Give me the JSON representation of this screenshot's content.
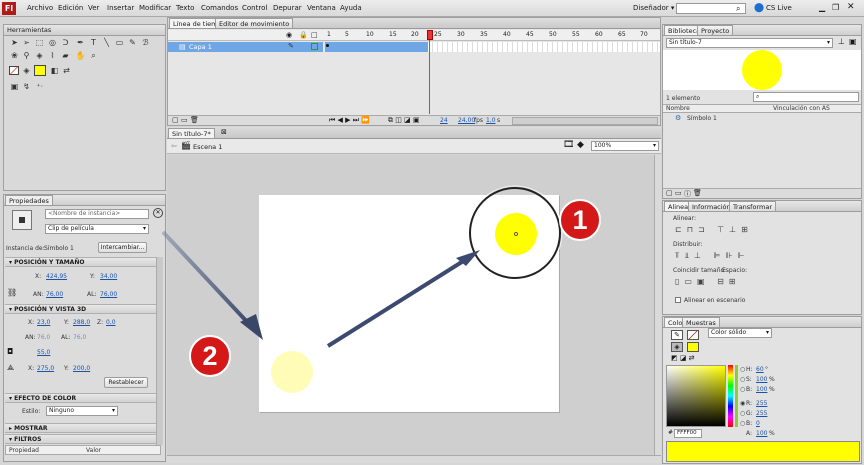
{
  "menu": [
    "Archivo",
    "Edición",
    "Ver",
    "Insertar",
    "Modificar",
    "Texto",
    "Comandos",
    "Control",
    "Depurar",
    "Ventana",
    "Ayuda"
  ],
  "app": {
    "logo": "Fl",
    "workspace": "Diseñador",
    "cslive": "CS Live",
    "search_placeholder": ""
  },
  "tools": {
    "title": "Herramientas"
  },
  "timeline": {
    "tabs": [
      "Línea de tiempo",
      "Editor de movimiento"
    ],
    "layer": "Capa 1",
    "frames": [
      "1",
      "5",
      "10",
      "15",
      "20",
      "25",
      "30",
      "35",
      "40",
      "45",
      "50",
      "55",
      "60",
      "65",
      "70"
    ],
    "frame_current": "24",
    "fps": "24,00",
    "fps_unit": "fps",
    "time": "1,0",
    "time_unit": "s"
  },
  "doc": {
    "tab": "Sin título-7*",
    "scene": "Escena 1",
    "zoom": "100%"
  },
  "properties": {
    "tab": "Propiedades",
    "instance_placeholder": "<Nombre de instancia>",
    "instance_type": "Clip de película",
    "instance_of_label": "Instancia de:",
    "instance_of": "Símbolo 1",
    "swap": "Intercambiar...",
    "sec_pos": "POSICIÓN Y TAMAÑO",
    "x_label": "X:",
    "x": "424,95",
    "y_label": "Y:",
    "y": "34,00",
    "w_label": "AN:",
    "w": "76,00",
    "h_label": "AL:",
    "h": "76,00",
    "sec_3d": "POSICIÓN Y VISTA 3D",
    "x3_label": "X:",
    "x3": "23,0",
    "y3_label": "Y:",
    "y3": "288,0",
    "z_label": "Z:",
    "z": "0,0",
    "w3_label": "AN:",
    "w3": "76,0",
    "h3_label": "AL:",
    "h3": "76,0",
    "persp": "55,0",
    "vx_label": "X:",
    "vx": "275,0",
    "vy_label": "Y:",
    "vy": "200,0",
    "reset": "Restablecer",
    "sec_color": "EFECTO DE COLOR",
    "style_label": "Estilo:",
    "style": "Ninguno",
    "sec_show": "MOSTRAR",
    "sec_filters": "FILTROS",
    "col_prop": "Propiedad",
    "col_val": "Valor"
  },
  "library": {
    "tabs": [
      "Biblioteca",
      "Proyecto"
    ],
    "doc": "Sin título-7",
    "count": "1 elemento",
    "col_name": "Nombre",
    "col_link": "Vinculación con AS",
    "item": "Símbolo 1"
  },
  "align": {
    "tabs": [
      "Alinear",
      "Información",
      "Transformar"
    ],
    "align": "Alinear:",
    "distribute": "Distribuir:",
    "match": "Coincidir tamaño:",
    "space": "Espacio:",
    "to_stage": "Alinear en escenario"
  },
  "color": {
    "tabs": [
      "Color",
      "Muestras"
    ],
    "type": "Color sólido",
    "h_label": "H:",
    "h": "60",
    "h_unit": "°",
    "s_label": "S:",
    "s": "100",
    "s_unit": "%",
    "b_label": "B:",
    "b": "100",
    "b_unit": "%",
    "r_label": "R:",
    "r": "255",
    "g_label": "G:",
    "g": "255",
    "bl_label": "B:",
    "bl": "0",
    "a_label": "A:",
    "a": "100",
    "a_unit": "%",
    "hex": "FFFF00",
    "swatch": "#ffff00"
  },
  "annotations": {
    "one": "1",
    "two": "2"
  },
  "colors": {
    "accent_blue": "#6fa7e6",
    "yellow": "#ffff00",
    "pale_yellow": "#fffcb8",
    "badge_red": "#d41818"
  }
}
